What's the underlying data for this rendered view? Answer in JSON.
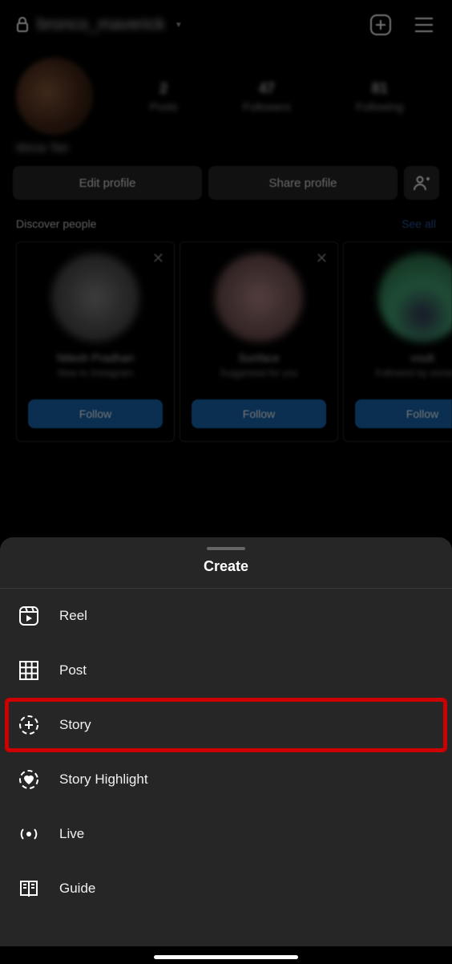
{
  "header": {
    "username": "bronco_maverick"
  },
  "profile": {
    "display_name": "Mona Tan",
    "stats": {
      "posts_num": "2",
      "posts_label": "Posts",
      "followers_num": "47",
      "followers_label": "Followers",
      "following_num": "81",
      "following_label": "Following"
    },
    "edit_btn": "Edit profile",
    "share_btn": "Share profile"
  },
  "discover": {
    "label": "Discover people",
    "see_all": "See all",
    "cards": [
      {
        "name": "Nitesh Pradhan",
        "sub": "New to Instagram",
        "follow": "Follow"
      },
      {
        "name": "Sunface",
        "sub": "Suggested for you",
        "follow": "Follow"
      },
      {
        "name": "voult",
        "sub": "Followed by someone",
        "follow": "Follow"
      }
    ]
  },
  "sheet": {
    "title": "Create",
    "items": [
      {
        "icon": "reel",
        "label": "Reel"
      },
      {
        "icon": "post",
        "label": "Post"
      },
      {
        "icon": "story",
        "label": "Story",
        "highlighted": true
      },
      {
        "icon": "highlight",
        "label": "Story Highlight"
      },
      {
        "icon": "live",
        "label": "Live"
      },
      {
        "icon": "guide",
        "label": "Guide"
      }
    ]
  }
}
